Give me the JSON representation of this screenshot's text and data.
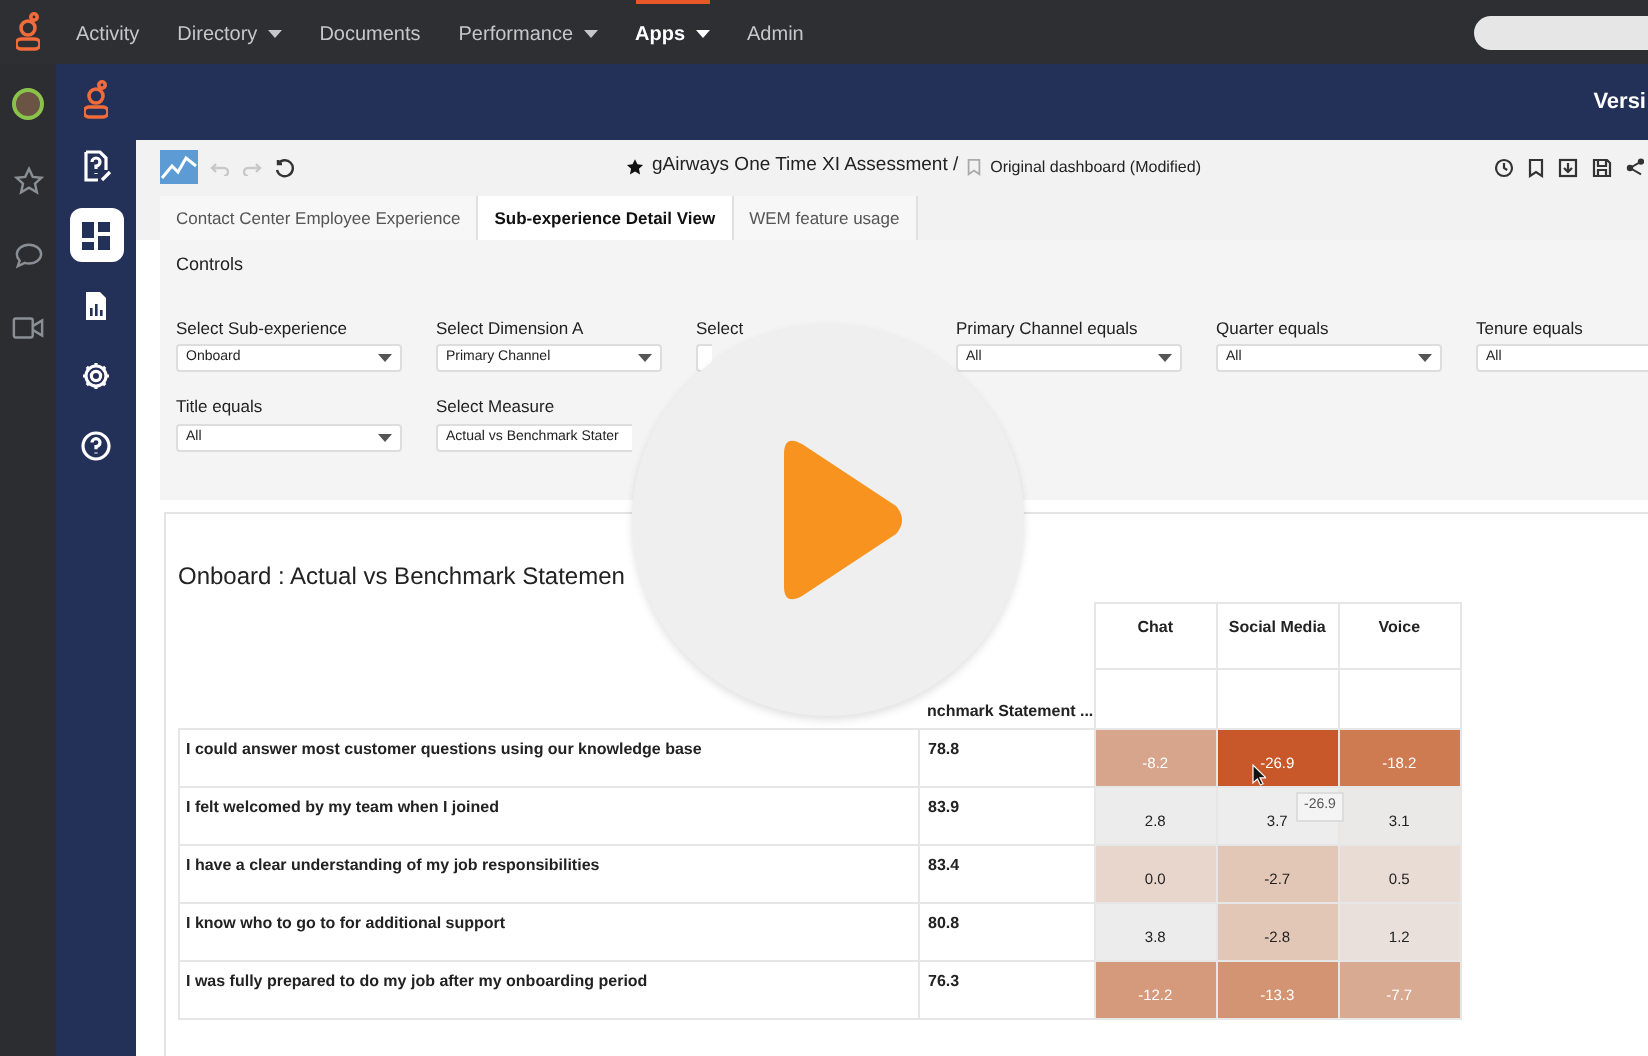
{
  "top_nav": {
    "items": [
      {
        "label": "Activity",
        "dropdown": false,
        "selected": false
      },
      {
        "label": "Directory",
        "dropdown": true,
        "selected": false
      },
      {
        "label": "Documents",
        "dropdown": false,
        "selected": false
      },
      {
        "label": "Performance",
        "dropdown": true,
        "selected": false
      },
      {
        "label": "Apps",
        "dropdown": true,
        "selected": true
      },
      {
        "label": "Admin",
        "dropdown": false,
        "selected": false
      }
    ]
  },
  "sidebar": {
    "items": [
      {
        "kind": "question-doc",
        "selected": false
      },
      {
        "kind": "dashboard",
        "selected": true
      },
      {
        "kind": "report",
        "selected": false
      },
      {
        "kind": "settings",
        "selected": false
      },
      {
        "kind": "help",
        "selected": false
      }
    ]
  },
  "header": {
    "version_text": "Versi"
  },
  "toolbar": {
    "favorite_title": "gAirways One Time XI Assessment /",
    "dashboard_name": "Original dashboard (Modified)"
  },
  "tabs": [
    {
      "label": "Contact Center Employee Experience",
      "selected": false
    },
    {
      "label": "Sub-experience Detail View",
      "selected": true
    },
    {
      "label": "WEM feature usage",
      "selected": false
    }
  ],
  "controls": {
    "title": "Controls",
    "filters": [
      {
        "label": "Select Sub-experience",
        "value": "Onboard",
        "kind": "dropdown"
      },
      {
        "label": "Select Dimension A",
        "value": "Primary Channel",
        "kind": "dropdown"
      },
      {
        "label": "Select",
        "kind": "covered"
      },
      {
        "label": "Primary Channel equals",
        "value": "All",
        "kind": "dropdown"
      },
      {
        "label": "Quarter equals",
        "value": "All",
        "kind": "dropdown"
      },
      {
        "label": "Tenure equals",
        "value": "All",
        "kind": "dropdown"
      },
      {
        "label": "Title equals",
        "value": "All",
        "kind": "dropdown"
      },
      {
        "label": "Select Measure",
        "value": "Actual vs Benchmark Stater",
        "kind": "cut"
      }
    ]
  },
  "table": {
    "title": "Onboard : Actual vs Benchmark Statemen",
    "benchmark_header": "nchmark Statement ...",
    "channels": [
      "Chat",
      "Social Media",
      "Voice"
    ],
    "rows": [
      {
        "statement": "I could answer most customer questions using our knowledge base",
        "benchmark": "78.8",
        "cells": [
          {
            "value": "-8.2",
            "color": "#d6a58c"
          },
          {
            "value": "-26.9",
            "color": "#c8582a"
          },
          {
            "value": "-18.2",
            "color": "#cf7b52"
          }
        ]
      },
      {
        "statement": "I felt welcomed by my team when I joined",
        "benchmark": "83.9",
        "cells": [
          {
            "value": "2.8",
            "color": "#ececec"
          },
          {
            "value": "3.7",
            "color": "#ededed"
          },
          {
            "value": "3.1",
            "color": "#ebe9e8"
          }
        ]
      },
      {
        "statement": "I have a clear understanding of my job responsibilities",
        "benchmark": "83.4",
        "cells": [
          {
            "value": "0.0",
            "color": "#e8d6cc"
          },
          {
            "value": "-2.7",
            "color": "#e3c7b6"
          },
          {
            "value": "0.5",
            "color": "#e8dcd5"
          }
        ]
      },
      {
        "statement": "I know who to go to for additional support",
        "benchmark": "80.8",
        "cells": [
          {
            "value": "3.8",
            "color": "#ececec"
          },
          {
            "value": "-2.8",
            "color": "#e3c7b6"
          },
          {
            "value": "1.2",
            "color": "#e9e0dc"
          }
        ]
      },
      {
        "statement": "I was fully prepared to do my job after my onboarding period",
        "benchmark": "76.3",
        "cells": [
          {
            "value": "-12.2",
            "color": "#d49a7b"
          },
          {
            "value": "-13.3",
            "color": "#d29472"
          },
          {
            "value": "-7.7",
            "color": "#d8aa92"
          }
        ]
      }
    ],
    "tooltip": "-26.9"
  }
}
